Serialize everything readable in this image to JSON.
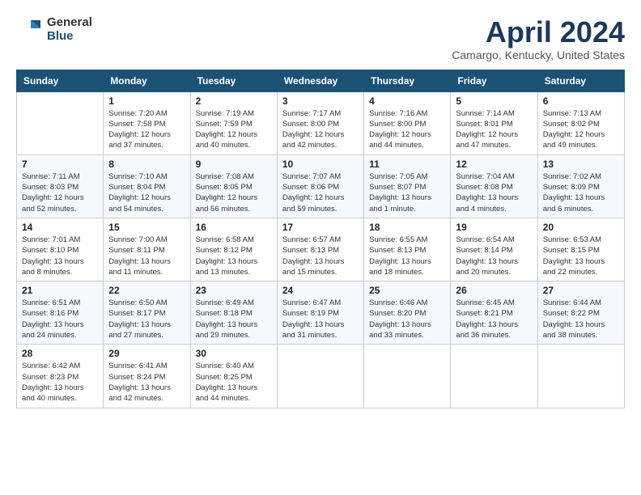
{
  "header": {
    "logo_general": "General",
    "logo_blue": "Blue",
    "title": "April 2024",
    "location": "Camargo, Kentucky, United States"
  },
  "columns": [
    "Sunday",
    "Monday",
    "Tuesday",
    "Wednesday",
    "Thursday",
    "Friday",
    "Saturday"
  ],
  "weeks": [
    [
      {
        "day": "",
        "info": ""
      },
      {
        "day": "1",
        "info": "Sunrise: 7:20 AM\nSunset: 7:58 PM\nDaylight: 12 hours\nand 37 minutes."
      },
      {
        "day": "2",
        "info": "Sunrise: 7:19 AM\nSunset: 7:59 PM\nDaylight: 12 hours\nand 40 minutes."
      },
      {
        "day": "3",
        "info": "Sunrise: 7:17 AM\nSunset: 8:00 PM\nDaylight: 12 hours\nand 42 minutes."
      },
      {
        "day": "4",
        "info": "Sunrise: 7:16 AM\nSunset: 8:00 PM\nDaylight: 12 hours\nand 44 minutes."
      },
      {
        "day": "5",
        "info": "Sunrise: 7:14 AM\nSunset: 8:01 PM\nDaylight: 12 hours\nand 47 minutes."
      },
      {
        "day": "6",
        "info": "Sunrise: 7:13 AM\nSunset: 8:02 PM\nDaylight: 12 hours\nand 49 minutes."
      }
    ],
    [
      {
        "day": "7",
        "info": "Sunrise: 7:11 AM\nSunset: 8:03 PM\nDaylight: 12 hours\nand 52 minutes."
      },
      {
        "day": "8",
        "info": "Sunrise: 7:10 AM\nSunset: 8:04 PM\nDaylight: 12 hours\nand 54 minutes."
      },
      {
        "day": "9",
        "info": "Sunrise: 7:08 AM\nSunset: 8:05 PM\nDaylight: 12 hours\nand 56 minutes."
      },
      {
        "day": "10",
        "info": "Sunrise: 7:07 AM\nSunset: 8:06 PM\nDaylight: 12 hours\nand 59 minutes."
      },
      {
        "day": "11",
        "info": "Sunrise: 7:05 AM\nSunset: 8:07 PM\nDaylight: 13 hours\nand 1 minute."
      },
      {
        "day": "12",
        "info": "Sunrise: 7:04 AM\nSunset: 8:08 PM\nDaylight: 13 hours\nand 4 minutes."
      },
      {
        "day": "13",
        "info": "Sunrise: 7:02 AM\nSunset: 8:09 PM\nDaylight: 13 hours\nand 6 minutes."
      }
    ],
    [
      {
        "day": "14",
        "info": "Sunrise: 7:01 AM\nSunset: 8:10 PM\nDaylight: 13 hours\nand 8 minutes."
      },
      {
        "day": "15",
        "info": "Sunrise: 7:00 AM\nSunset: 8:11 PM\nDaylight: 13 hours\nand 11 minutes."
      },
      {
        "day": "16",
        "info": "Sunrise: 6:58 AM\nSunset: 8:12 PM\nDaylight: 13 hours\nand 13 minutes."
      },
      {
        "day": "17",
        "info": "Sunrise: 6:57 AM\nSunset: 8:13 PM\nDaylight: 13 hours\nand 15 minutes."
      },
      {
        "day": "18",
        "info": "Sunrise: 6:55 AM\nSunset: 8:13 PM\nDaylight: 13 hours\nand 18 minutes."
      },
      {
        "day": "19",
        "info": "Sunrise: 6:54 AM\nSunset: 8:14 PM\nDaylight: 13 hours\nand 20 minutes."
      },
      {
        "day": "20",
        "info": "Sunrise: 6:53 AM\nSunset: 8:15 PM\nDaylight: 13 hours\nand 22 minutes."
      }
    ],
    [
      {
        "day": "21",
        "info": "Sunrise: 6:51 AM\nSunset: 8:16 PM\nDaylight: 13 hours\nand 24 minutes."
      },
      {
        "day": "22",
        "info": "Sunrise: 6:50 AM\nSunset: 8:17 PM\nDaylight: 13 hours\nand 27 minutes."
      },
      {
        "day": "23",
        "info": "Sunrise: 6:49 AM\nSunset: 8:18 PM\nDaylight: 13 hours\nand 29 minutes."
      },
      {
        "day": "24",
        "info": "Sunrise: 6:47 AM\nSunset: 8:19 PM\nDaylight: 13 hours\nand 31 minutes."
      },
      {
        "day": "25",
        "info": "Sunrise: 6:46 AM\nSunset: 8:20 PM\nDaylight: 13 hours\nand 33 minutes."
      },
      {
        "day": "26",
        "info": "Sunrise: 6:45 AM\nSunset: 8:21 PM\nDaylight: 13 hours\nand 36 minutes."
      },
      {
        "day": "27",
        "info": "Sunrise: 6:44 AM\nSunset: 8:22 PM\nDaylight: 13 hours\nand 38 minutes."
      }
    ],
    [
      {
        "day": "28",
        "info": "Sunrise: 6:42 AM\nSunset: 8:23 PM\nDaylight: 13 hours\nand 40 minutes."
      },
      {
        "day": "29",
        "info": "Sunrise: 6:41 AM\nSunset: 8:24 PM\nDaylight: 13 hours\nand 42 minutes."
      },
      {
        "day": "30",
        "info": "Sunrise: 6:40 AM\nSunset: 8:25 PM\nDaylight: 13 hours\nand 44 minutes."
      },
      {
        "day": "",
        "info": ""
      },
      {
        "day": "",
        "info": ""
      },
      {
        "day": "",
        "info": ""
      },
      {
        "day": "",
        "info": ""
      }
    ]
  ]
}
